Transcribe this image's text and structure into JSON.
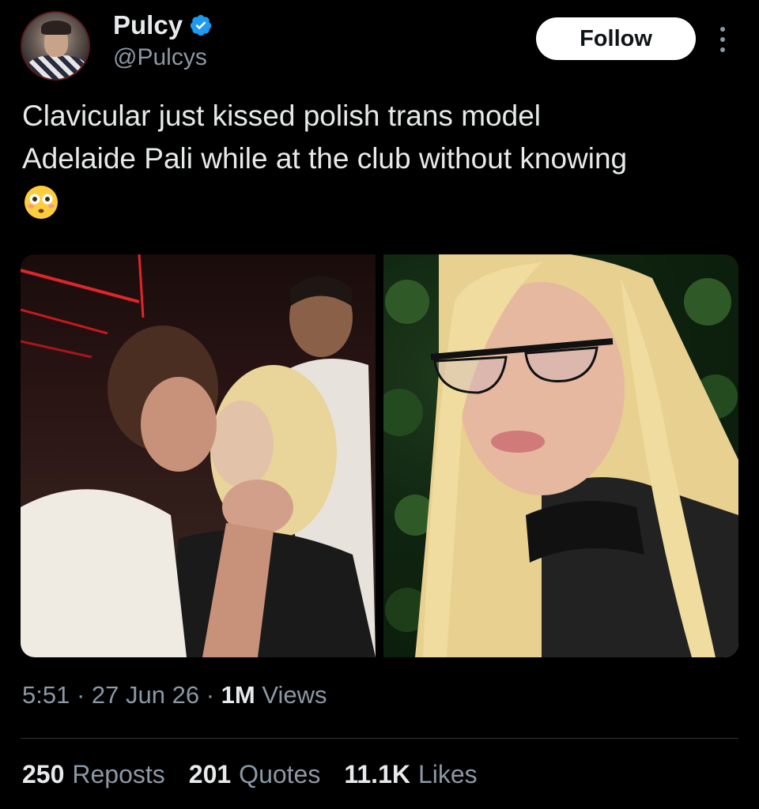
{
  "author": {
    "display_name": "Pulcy",
    "handle": "@Pulcys",
    "verified_icon": "verified-badge-icon",
    "avatar_icon": "avatar"
  },
  "follow_button": {
    "label": "Follow"
  },
  "more_icon": "more-options-icon",
  "tweet": {
    "text": "Clavicular just kissed polish trans model\nAdelaide Pali while at the club without knowing",
    "emoji": "flushed-face-icon"
  },
  "media": {
    "left_photo": "photo-club",
    "right_photo": "photo-portrait"
  },
  "meta": {
    "time": "5:51",
    "separator1": " · ",
    "date": "27 Jun 26",
    "separator2": " · ",
    "views_count": "1M",
    "views_label": " Views"
  },
  "stats": {
    "reposts_count": "250",
    "reposts_label": "Reposts",
    "quotes_count": "201",
    "quotes_label": "Quotes",
    "likes_count": "11.1K",
    "likes_label": "Likes"
  },
  "colors": {
    "background": "#000000",
    "text": "#e7e9ea",
    "muted": "#8b98a5",
    "verified": "#1d9bf0",
    "button_bg": "#ffffff",
    "divider": "#2f3336"
  }
}
